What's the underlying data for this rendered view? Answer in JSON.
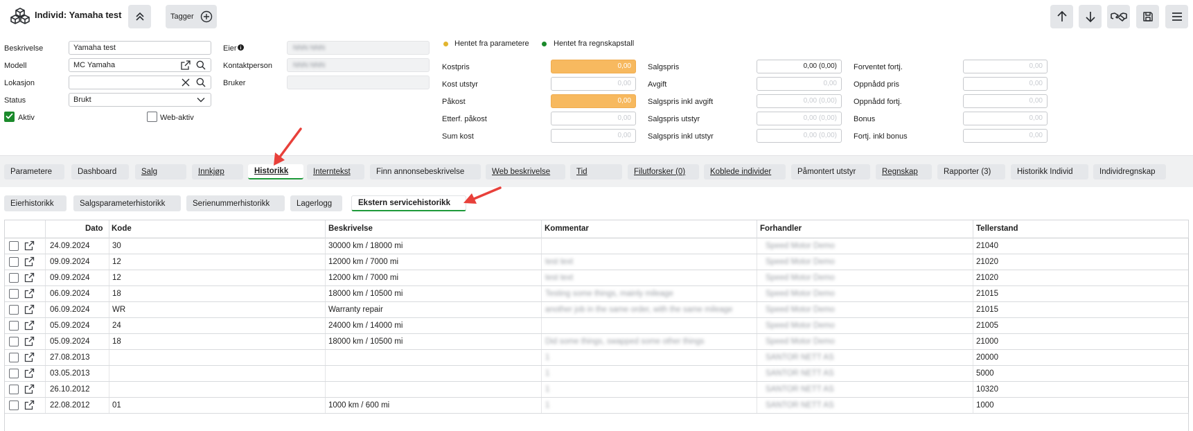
{
  "header": {
    "title": "Individ: Yamaha test",
    "tag_label": "Tagger",
    "icons": [
      "cubes-icon",
      "chevrons-up-icon",
      "plus-circle-icon",
      "arrow-up-icon",
      "arrow-down-icon",
      "handshake-icon",
      "save-icon",
      "menu-icon"
    ]
  },
  "form": {
    "beskrivelse_label": "Beskrivelse",
    "beskrivelse_value": "Yamaha test",
    "modell_label": "Modell",
    "modell_value": "MC Yamaha",
    "lokasjon_label": "Lokasjon",
    "lokasjon_value": "",
    "status_label": "Status",
    "status_value": "Brukt",
    "aktiv_label": "Aktiv",
    "aktiv_checked": true,
    "webaktiv_label": "Web-aktiv",
    "webaktiv_checked": false,
    "eier_label": "Eier",
    "kontaktperson_label": "Kontaktperson",
    "bruker_label": "Bruker",
    "eier_value": "NNN NNN",
    "kontaktperson_value": "NNN NNN"
  },
  "legend": {
    "parametere": "Hentet fra parametere",
    "regnskap": "Hentet fra regnskapstall",
    "parametere_color": "#e2b52f",
    "regnskap_color": "#1b8a2b"
  },
  "pricing": {
    "col1": [
      {
        "label": "Kostpris",
        "value": "0,00"
      },
      {
        "label": "Kost utstyr",
        "value": "0,00"
      },
      {
        "label": "Påkost",
        "value": "0,00"
      },
      {
        "label": "Etterf. påkost",
        "value": "0,00"
      },
      {
        "label": "Sum kost",
        "value": "0,00"
      }
    ],
    "col2": [
      {
        "label": "Salgspris",
        "value": "0,00 (0,00)"
      },
      {
        "label": "Avgift",
        "value": "0,00"
      },
      {
        "label": "Salgspris inkl avgift",
        "value": "0,00 (0,00)"
      },
      {
        "label": "Salgspris utstyr",
        "value": "0,00 (0,00)"
      },
      {
        "label": "Salgspris inkl utstyr",
        "value": "0,00 (0,00)"
      }
    ],
    "col3": [
      {
        "label": "Forventet fortj.",
        "value": "0,00"
      },
      {
        "label": "Oppnådd pris",
        "value": "0,00"
      },
      {
        "label": "Oppnådd fortj.",
        "value": "0,00"
      },
      {
        "label": "Bonus",
        "value": "0,00"
      },
      {
        "label": "Fortj. inkl bonus",
        "value": "0,00"
      }
    ]
  },
  "tabs": [
    {
      "id": "parametere",
      "label": "Parametere"
    },
    {
      "id": "dashboard",
      "label": "Dashboard"
    },
    {
      "id": "salg",
      "label": "Salg"
    },
    {
      "id": "innkjop",
      "label": "Innkjøp"
    },
    {
      "id": "historikk",
      "label": "Historikk"
    },
    {
      "id": "interntekst",
      "label": "Interntekst"
    },
    {
      "id": "finn",
      "label": "Finn annonsebeskrivelse"
    },
    {
      "id": "web",
      "label": "Web beskrivelse"
    },
    {
      "id": "tid",
      "label": "Tid"
    },
    {
      "id": "filutforsker",
      "label": "Filutforsker (0)"
    },
    {
      "id": "koblede",
      "label": "Koblede individer"
    },
    {
      "id": "pamontert",
      "label": "Påmontert utstyr"
    },
    {
      "id": "regnskap",
      "label": "Regnskap"
    },
    {
      "id": "rapporter",
      "label": "Rapporter (3)"
    },
    {
      "id": "historikkindivid",
      "label": "Historikk Individ"
    },
    {
      "id": "individregnskap",
      "label": "Individregnskap"
    }
  ],
  "subtabs": [
    {
      "id": "eier",
      "label": "Eierhistorikk"
    },
    {
      "id": "salgspar",
      "label": "Salgsparameterhistorikk"
    },
    {
      "id": "serienr",
      "label": "Serienummerhistorikk"
    },
    {
      "id": "lagerlogg",
      "label": "Lagerlogg"
    },
    {
      "id": "ekstern",
      "label": "Ekstern servicehistorikk"
    }
  ],
  "table": {
    "columns": [
      "Dato",
      "Kode",
      "Beskrivelse",
      "Kommentar",
      "Forhandler",
      "Tellerstand"
    ],
    "rows": [
      {
        "dato": "24.09.2024",
        "kode": "30",
        "beskrivelse": "30000 km / 18000 mi",
        "kommentar": "",
        "forhandler": "Speed Motor Demo",
        "tellerstand": "21040"
      },
      {
        "dato": "09.09.2024",
        "kode": "12",
        "beskrivelse": "12000 km / 7000 mi",
        "kommentar": "test text",
        "forhandler": "Speed Motor Demo",
        "tellerstand": "21020"
      },
      {
        "dato": "09.09.2024",
        "kode": "12",
        "beskrivelse": "12000 km / 7000 mi",
        "kommentar": "test text",
        "forhandler": "Speed Motor Demo",
        "tellerstand": "21020"
      },
      {
        "dato": "06.09.2024",
        "kode": "18",
        "beskrivelse": "18000 km / 10500 mi",
        "kommentar": "Testing some things, mainly mileage",
        "forhandler": "Speed Motor Demo",
        "tellerstand": "21015"
      },
      {
        "dato": "06.09.2024",
        "kode": "WR",
        "beskrivelse": "Warranty repair",
        "kommentar": "another job in the same order, with the same mileage",
        "forhandler": "Speed Motor Demo",
        "tellerstand": "21015"
      },
      {
        "dato": "05.09.2024",
        "kode": "24",
        "beskrivelse": "24000 km / 14000 mi",
        "kommentar": "",
        "forhandler": "Speed Motor Demo",
        "tellerstand": "21005"
      },
      {
        "dato": "05.09.2024",
        "kode": "18",
        "beskrivelse": "18000 km / 10500 mi",
        "kommentar": "Did some things, swapped some other things",
        "forhandler": "Speed Motor Demo",
        "tellerstand": "21000"
      },
      {
        "dato": "27.08.2013",
        "kode": "",
        "beskrivelse": "",
        "kommentar": "1",
        "forhandler": "SANTOR NETT AS",
        "tellerstand": "20000"
      },
      {
        "dato": "03.05.2013",
        "kode": "",
        "beskrivelse": "",
        "kommentar": "1",
        "forhandler": "SANTOR NETT AS",
        "tellerstand": "5000"
      },
      {
        "dato": "26.10.2012",
        "kode": "",
        "beskrivelse": "",
        "kommentar": "1",
        "forhandler": "SANTOR NETT AS",
        "tellerstand": "10320"
      },
      {
        "dato": "22.08.2012",
        "kode": "01",
        "beskrivelse": "1000 km / 600 mi",
        "kommentar": "1",
        "forhandler": "SANTOR NETT AS",
        "tellerstand": "1000"
      }
    ]
  },
  "colors": {
    "accent_green": "#1e9a3a",
    "orange_field": "#f7b95f",
    "annotation_red": "#e8403a"
  }
}
